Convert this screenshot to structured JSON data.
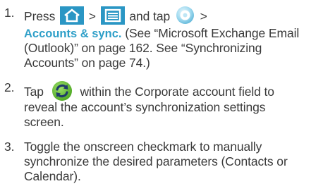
{
  "steps": [
    {
      "number": "1.",
      "press_text": "Press",
      "sep1": ">",
      "and_tap": "and tap",
      "sep2": ">",
      "menu_path": "Accounts & sync.",
      "ref1": " (See “Microsoft Exchange Email",
      "line2": "(Outlook)” on page 162. See “Synchronizing",
      "line3": "Accounts” on page 74.)"
    },
    {
      "number": "2.",
      "tap_text": "Tap",
      "line1_rest": "within the Corporate account field to",
      "line2": "reveal the account’s synchronization settings",
      "line3": "screen."
    },
    {
      "number": "3.",
      "line1": "Toggle the onscreen checkmark to manually",
      "line2": "synchronize the desired parameters (Contacts or",
      "line3": "Calendar)."
    }
  ],
  "icons": {
    "home": "home-key-icon",
    "menu": "menu-key-icon",
    "settings": "settings-icon",
    "sync": "sync-icon"
  },
  "colors": {
    "text": "#3a3a3a",
    "accent": "#2e9fc8",
    "key_bg": "#2a96c4",
    "sync_green": "#5cb82e"
  }
}
